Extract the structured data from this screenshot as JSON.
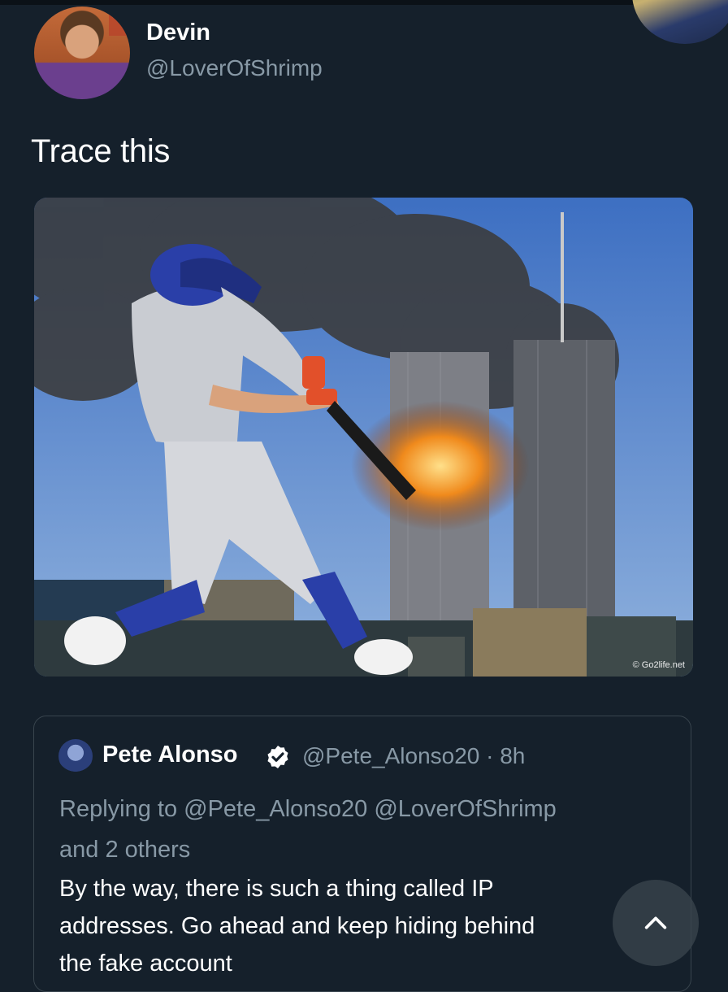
{
  "tweet": {
    "display_name": "Devin",
    "handle": "@LoverOfShrimp",
    "text": "Trace this",
    "media": {
      "watermark": "© Go2life.net"
    }
  },
  "quoted_tweet": {
    "display_name": "Pete Alonso",
    "handle_time": "@Pete_Alonso20 · 8h",
    "replying_to_line1": "Replying to @Pete_Alonso20 @LoverOfShrimp",
    "replying_to_line2": "and 2 others",
    "body_line1": "By the way, there is such a thing called IP",
    "body_line2": "addresses. Go ahead and keep hiding behind",
    "body_line3": "the fake account"
  },
  "icons": {
    "verified": "verified-badge-icon",
    "scroll_top": "chevron-up-icon"
  },
  "colors": {
    "background": "#15202b",
    "secondary_text": "#8899a6",
    "border": "#38444d"
  }
}
